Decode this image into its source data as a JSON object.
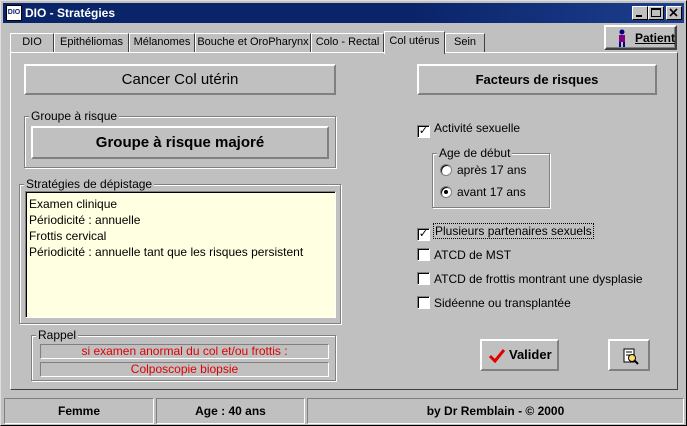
{
  "window": {
    "title": "DIO - Stratégies",
    "icon": "app-dio-icon"
  },
  "tabs": [
    {
      "label": "DIO"
    },
    {
      "label": "Epithéliomas"
    },
    {
      "label": "Mélanomes"
    },
    {
      "label": "Bouche et OroPharynx"
    },
    {
      "label": "Colo - Rectal"
    },
    {
      "label": "Col utérus",
      "active": true
    },
    {
      "label": "Sein"
    }
  ],
  "patient_button": {
    "label": "Patient",
    "icon": "patient-figure-icon"
  },
  "left": {
    "heading": "Cancer Col utérin",
    "risk_group": {
      "title": "Groupe à risque",
      "value": "Groupe à risque majoré"
    },
    "strategies": {
      "title": "Stratégies de dépistage",
      "lines": [
        "Examen clinique",
        "Périodicité : annuelle",
        "Frottis cervical",
        "Périodicité : annuelle tant que les risques persistent"
      ]
    },
    "rappel": {
      "title": "Rappel",
      "line1": "si examen anormal du col et/ou frottis :",
      "line2": "Colposcopie biopsie"
    }
  },
  "right": {
    "heading": "Facteurs de risques",
    "activite": {
      "label": "Activité sexuelle",
      "checked": true
    },
    "age_debut": {
      "title": "Age de début",
      "options": [
        {
          "label": "après 17 ans",
          "selected": false
        },
        {
          "label": "avant 17 ans",
          "selected": true
        }
      ]
    },
    "factors": [
      {
        "label": "Plusieurs partenaires sexuels",
        "checked": true
      },
      {
        "label": "ATCD de MST",
        "checked": false
      },
      {
        "label": "ATCD de frottis montrant une dysplasie",
        "checked": false
      },
      {
        "label": "Sidéenne ou transplantée",
        "checked": false
      }
    ],
    "valider_button": {
      "label": "Valider",
      "icon": "checkmark-icon"
    },
    "print_button": {
      "icon": "print-preview-icon"
    }
  },
  "status_bar": {
    "sex": "Femme",
    "age": "Age : 40 ans",
    "credit": "by Dr Remblain - © 2000"
  }
}
